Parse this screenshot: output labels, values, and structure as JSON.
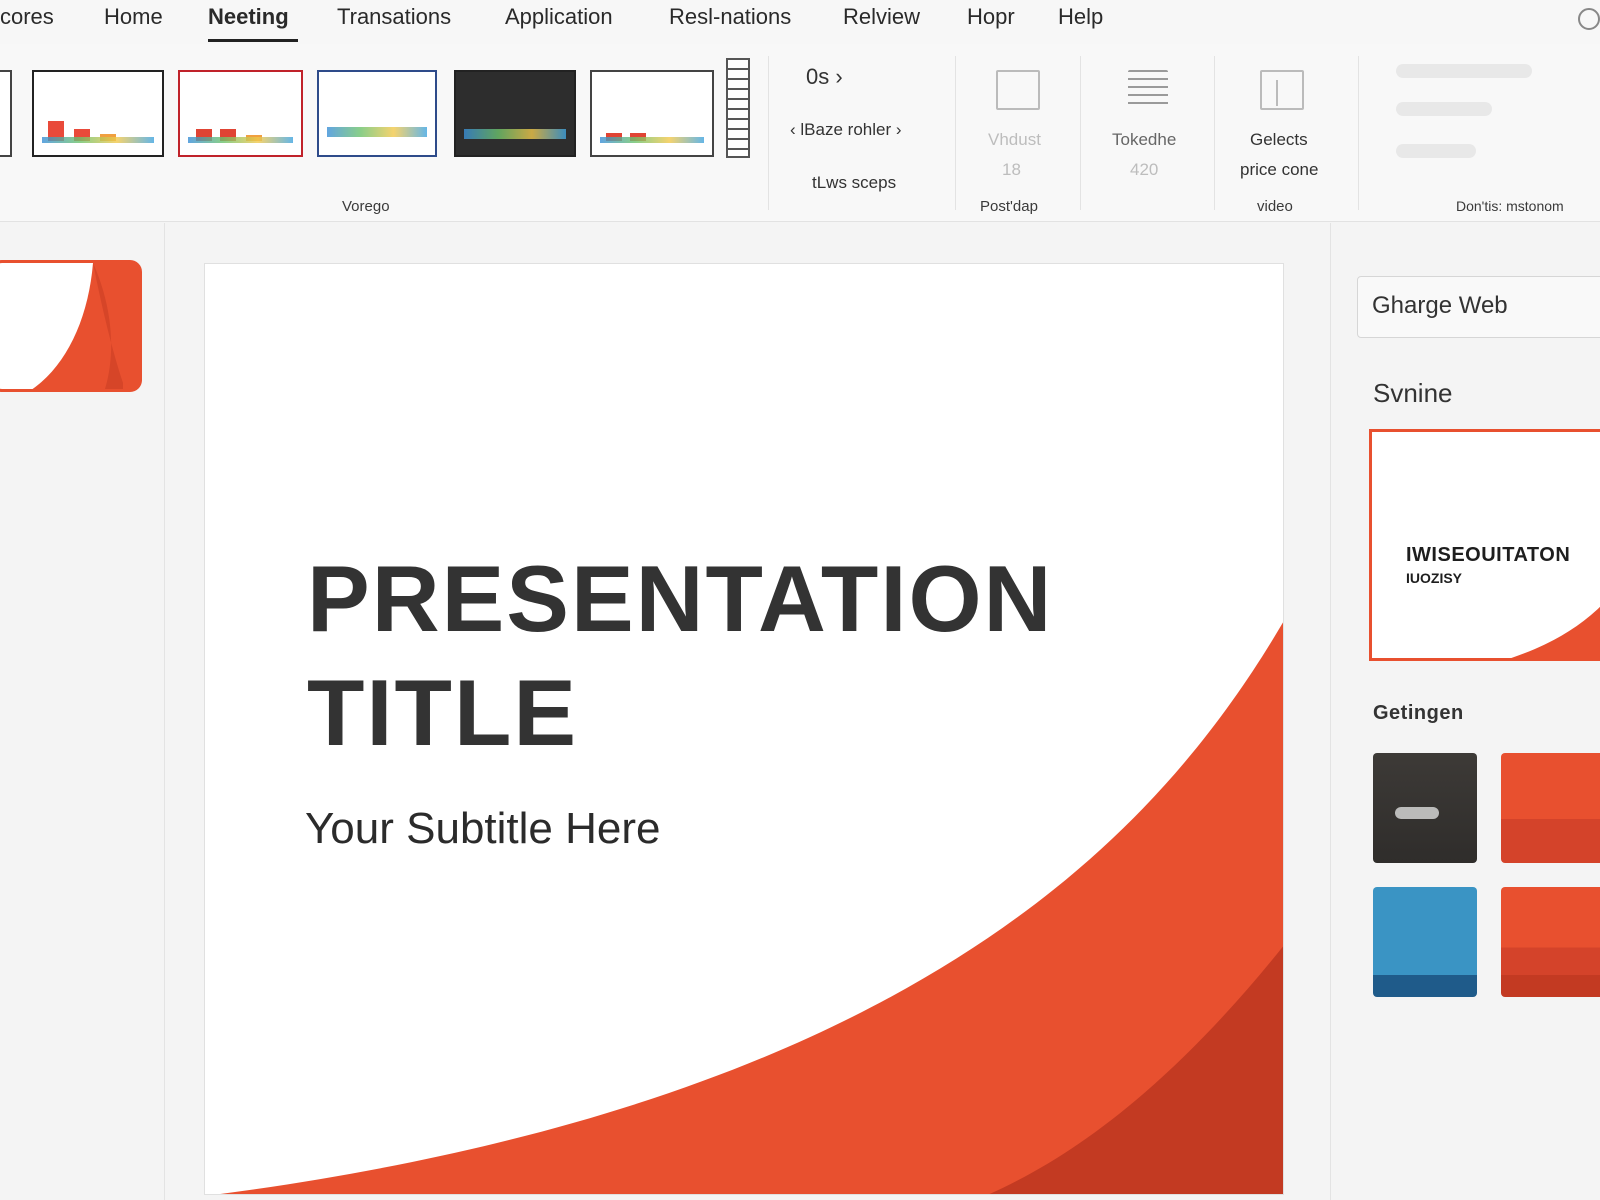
{
  "menu": {
    "items": [
      {
        "label": "cores",
        "active": false
      },
      {
        "label": "Home",
        "active": false
      },
      {
        "label": "Neeting",
        "active": true
      },
      {
        "label": "Transations",
        "active": false
      },
      {
        "label": "Application",
        "active": false
      },
      {
        "label": "Resl-nations",
        "active": false
      },
      {
        "label": "Relview",
        "active": false
      },
      {
        "label": "Hopr",
        "active": false
      },
      {
        "label": "Help",
        "active": false
      }
    ]
  },
  "ribbon": {
    "themes_group_label": "Vorego",
    "option_top": "0s",
    "option_mid": "lBaze rohler",
    "option_bottom": "tLws sceps",
    "btn_vhdust": {
      "label": "Vhdust",
      "value": "18"
    },
    "btn_tokedhe": {
      "label": "Tokedhe",
      "value": "420"
    },
    "postdap_group_label": "Post'dap",
    "btn_gelects": {
      "line1": "Gelects",
      "line2": "price cone"
    },
    "video_group_label": "video",
    "last_group_label": "Don'tis: mstonom"
  },
  "right_pane": {
    "search_value": "Gharge Web",
    "section_heading": "Svnine",
    "preview_title": "IWISEOUITATON",
    "preview_subtitle": "IUOZISY",
    "swatches_heading": "Getingen"
  },
  "slide": {
    "title": "PRESENTATION\nTITLE",
    "subtitle": "Your Subtitle Here"
  },
  "colors": {
    "accent": "#e8502f",
    "accent_dark": "#c33a22",
    "text_dark": "#333333",
    "swatch_dark": "#3d3a37",
    "swatch_blue": "#3a94c4"
  },
  "icons": [
    "chevron-right-icon",
    "chevron-left-icon",
    "cursor-icon",
    "frame-icon",
    "lines-icon",
    "panel-icon",
    "account-icon"
  ]
}
